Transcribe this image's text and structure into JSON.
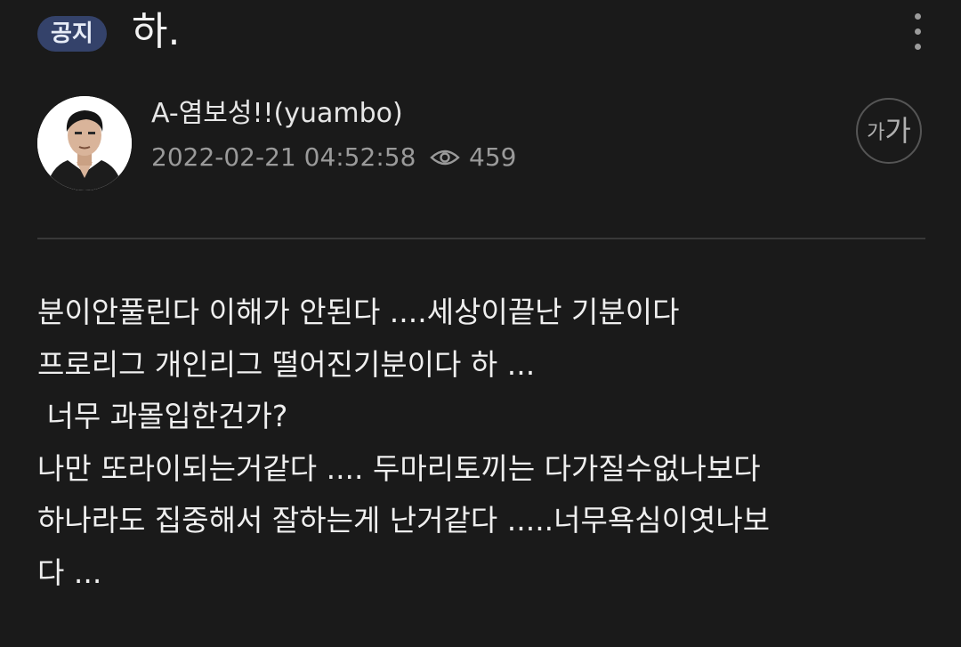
{
  "post": {
    "badge": "공지",
    "title": "하."
  },
  "author": {
    "name": "A-염보성!!(yuambo)",
    "date": "2022-02-21 04:52:58",
    "views": "459"
  },
  "icons": {
    "more": "more-vertical-icon",
    "views": "eye-icon",
    "font_size": "font-size-icon"
  },
  "font_size_button": {
    "small_label": "가",
    "large_label": "가"
  },
  "body_lines": [
    "분이안풀린다 이해가 안된다 ....세상이끝난 기분이다",
    "프로리그 개인리그 떨어진기분이다 하 ...",
    " 너무 과몰입한건가?",
    "나만 또라이되는거같다 .... 두마리토끼는 다가질수없나보다",
    "하나라도 집중해서 잘하는게 난거같다 .....너무욕심이엿나보",
    "다 ..."
  ],
  "colors": {
    "background": "#1a1a1a",
    "badge_bg": "#34426a",
    "meta_text": "#9a9a9a",
    "divider": "#383838"
  }
}
